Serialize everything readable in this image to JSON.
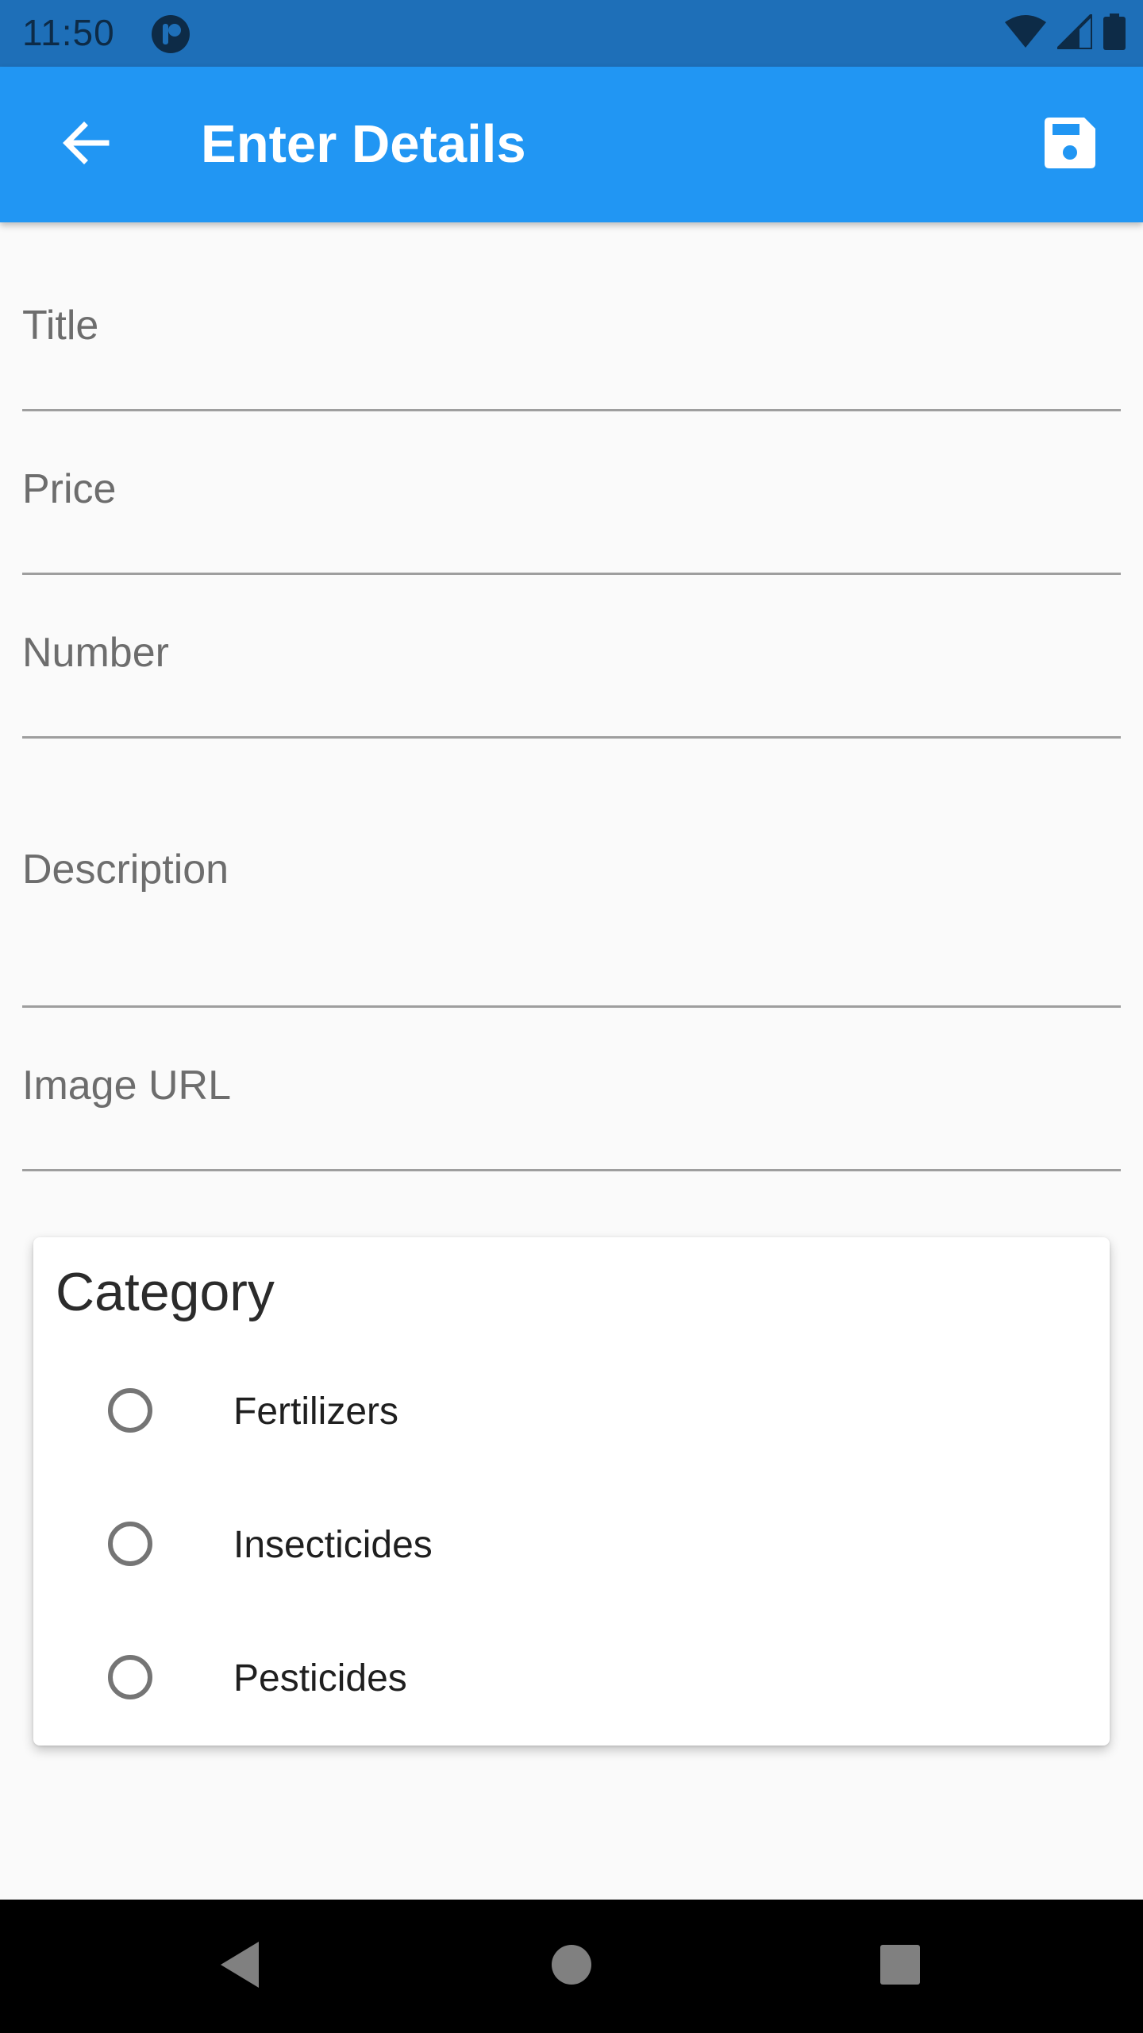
{
  "status_bar": {
    "time": "11:50",
    "icons": [
      "app-notification-icon",
      "wifi-icon",
      "signal-icon",
      "battery-icon"
    ]
  },
  "app_bar": {
    "title": "Enter Details",
    "back_icon": "arrow-back-icon",
    "save_icon": "save-icon",
    "color": "#2196f3"
  },
  "form": {
    "title_label": "Title",
    "price_label": "Price",
    "number_label": "Number",
    "description_label": "Description",
    "image_url_label": "Image URL"
  },
  "category": {
    "title": "Category",
    "options": [
      {
        "label": "Fertilizers",
        "selected": false
      },
      {
        "label": "Insecticides",
        "selected": false
      },
      {
        "label": "Pesticides",
        "selected": false
      }
    ]
  },
  "nav_bar": {
    "buttons": [
      "back-triangle-icon",
      "home-circle-icon",
      "recents-square-icon"
    ]
  }
}
